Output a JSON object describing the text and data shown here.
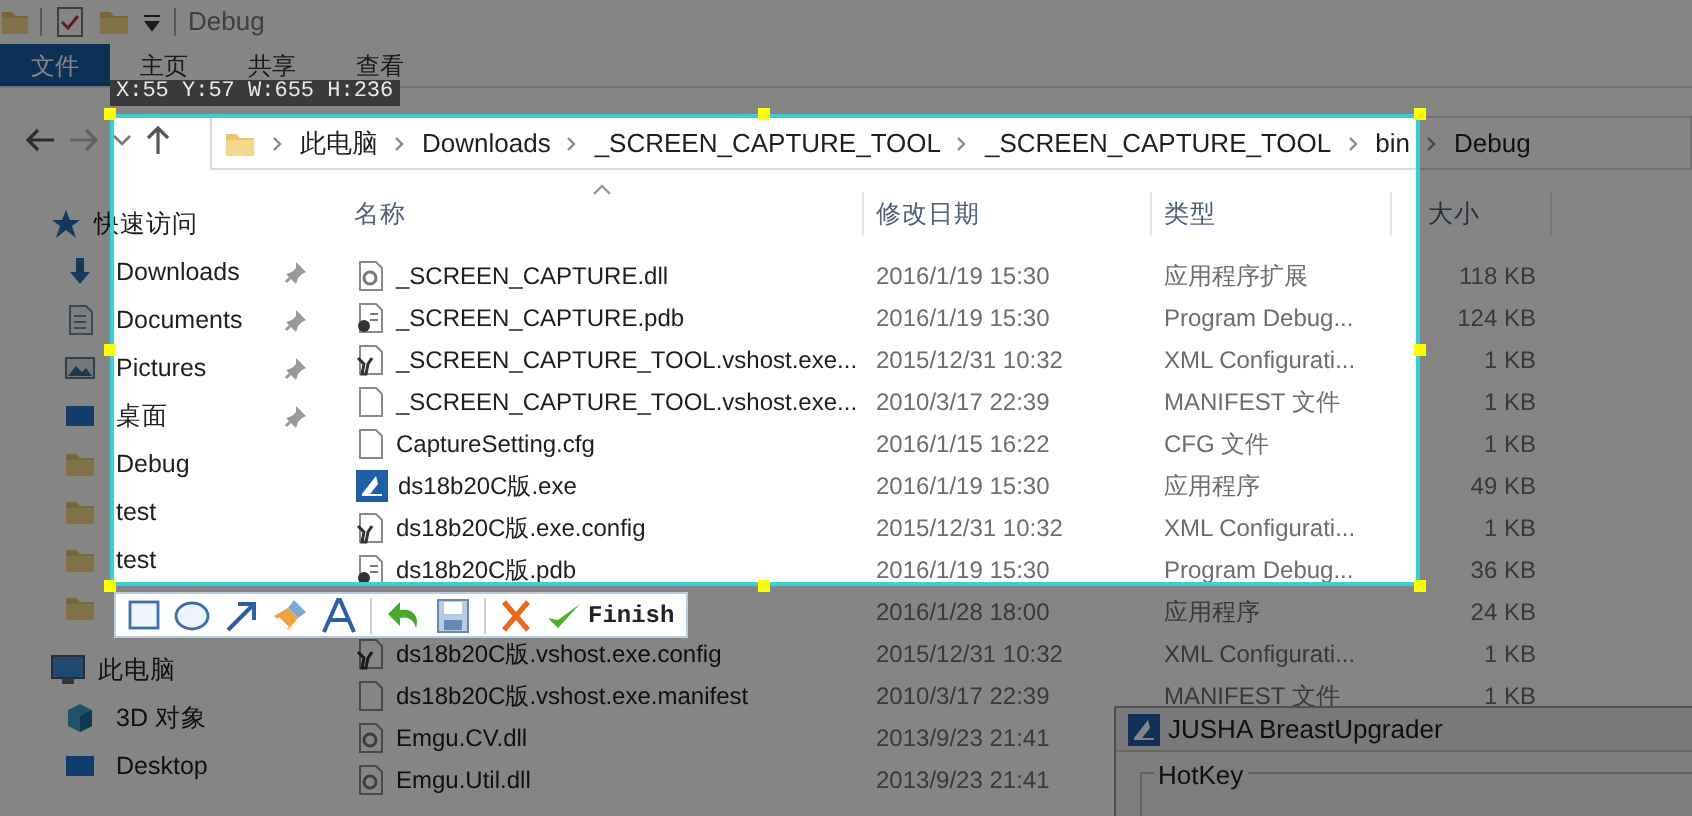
{
  "window": {
    "title": "Debug"
  },
  "ribbon_tabs": [
    {
      "label": "文件",
      "kind": "file"
    },
    {
      "label": "主页",
      "kind": "tab"
    },
    {
      "label": "共享",
      "kind": "tab"
    },
    {
      "label": "查看",
      "kind": "tab"
    }
  ],
  "address_bar": {
    "path": [
      "此电脑",
      "Downloads",
      "_SCREEN_CAPTURE_TOOL",
      "_SCREEN_CAPTURE_TOOL",
      "bin",
      "Debug"
    ]
  },
  "navigation_pane": {
    "items": [
      {
        "label": "快速访问",
        "kind": "star",
        "children": [
          {
            "label": "Downloads",
            "kind": "download",
            "pinned": true
          },
          {
            "label": "Documents",
            "kind": "document",
            "pinned": true
          },
          {
            "label": "Pictures",
            "kind": "pictures",
            "pinned": true
          },
          {
            "label": "桌面",
            "kind": "desktop",
            "pinned": true
          },
          {
            "label": "Debug",
            "kind": "folder",
            "pinned": false
          },
          {
            "label": "test",
            "kind": "folder",
            "pinned": false
          },
          {
            "label": "test",
            "kind": "folder",
            "pinned": false
          },
          {
            "kind": "folder",
            "pinned": false
          }
        ]
      },
      {
        "label": "此电脑",
        "kind": "pc",
        "children": [
          {
            "label": "3D 对象",
            "kind": "cube",
            "pinned": false
          },
          {
            "label": "Desktop",
            "kind": "desktop",
            "pinned": false
          }
        ]
      }
    ]
  },
  "files": {
    "columns": [
      "名称",
      "修改日期",
      "类型",
      "大小"
    ],
    "rows": [
      {
        "kind": "dll",
        "name": "_SCREEN_CAPTURE.dll",
        "date": "2016/1/19 15:30",
        "type": "应用程序扩展",
        "size": "118 KB"
      },
      {
        "kind": "pdb",
        "name": "_SCREEN_CAPTURE.pdb",
        "date": "2016/1/19 15:30",
        "type": "Program Debug...",
        "size": "124 KB"
      },
      {
        "kind": "config",
        "name": "_SCREEN_CAPTURE_TOOL.vshost.exe...",
        "date": "2015/12/31 10:32",
        "type": "XML Configurati...",
        "size": "1 KB"
      },
      {
        "kind": "file",
        "name": "_SCREEN_CAPTURE_TOOL.vshost.exe...",
        "date": "2010/3/17 22:39",
        "type": "MANIFEST 文件",
        "size": "1 KB"
      },
      {
        "kind": "file",
        "name": "CaptureSetting.cfg",
        "date": "2016/1/15 16:22",
        "type": "CFG 文件",
        "size": "1 KB"
      },
      {
        "kind": "exe",
        "name": "ds18b20C版.exe",
        "date": "2016/1/19 15:30",
        "type": "应用程序",
        "size": "49 KB"
      },
      {
        "kind": "config",
        "name": "ds18b20C版.exe.config",
        "date": "2015/12/31 10:32",
        "type": "XML Configurati...",
        "size": "1 KB"
      },
      {
        "kind": "pdb",
        "name": "ds18b20C版.pdb",
        "date": "2016/1/19 15:30",
        "type": "Program Debug...",
        "size": "36 KB"
      },
      {
        "date": "2016/1/28 18:00",
        "type": "应用程序",
        "size": "24 KB"
      },
      {
        "kind": "config",
        "name": "ds18b20C版.vshost.exe.config",
        "date": "2015/12/31 10:32",
        "type": "XML Configurati...",
        "size": "1 KB"
      },
      {
        "kind": "file",
        "name": "ds18b20C版.vshost.exe.manifest",
        "date": "2010/3/17 22:39",
        "type": "MANIFEST 文件",
        "size": "1 KB"
      },
      {
        "kind": "dll",
        "name": "Emgu.CV.dll",
        "date": "2013/9/23 21:41"
      },
      {
        "kind": "dll",
        "name": "Emgu.Util.dll",
        "date": "2013/9/23 21:41"
      }
    ]
  },
  "dialog": {
    "title": "JUSHA BreastUpgrader",
    "group_label": "HotKey"
  },
  "capture": {
    "readout": "X:55 Y:57 W:655 H:236",
    "finish_label": "Finish"
  }
}
